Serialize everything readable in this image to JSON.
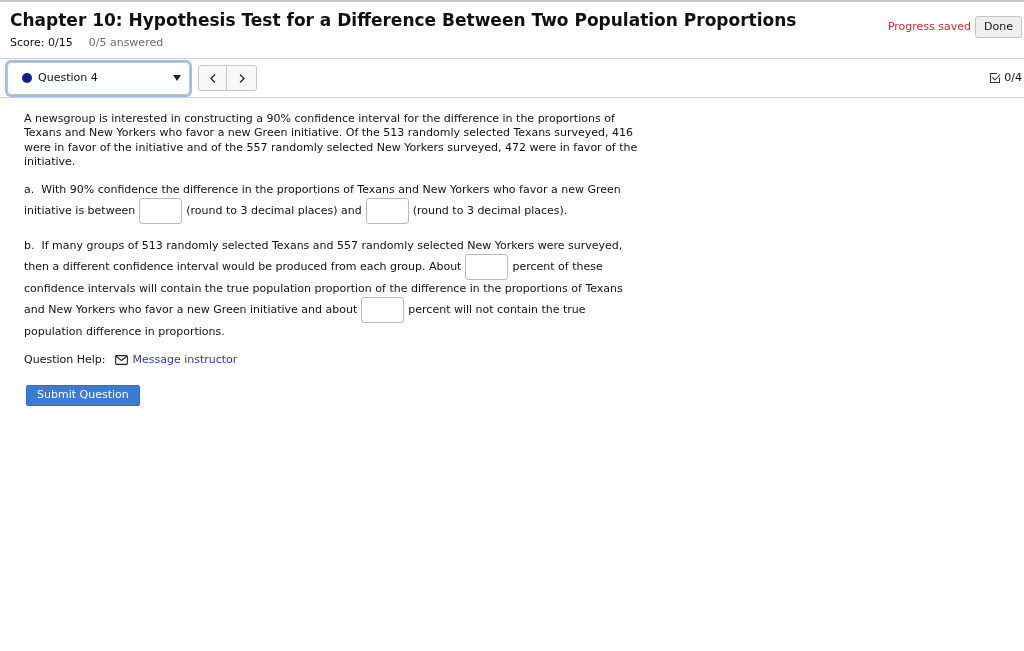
{
  "header": {
    "title": "Chapter 10: Hypothesis Test for a Difference Between Two Population Proportions",
    "score": "Score: 0/15",
    "answered": "0/5 answered",
    "status": "Progress saved",
    "done_button": "Done"
  },
  "question_nav": {
    "selector": "Question 4",
    "progress": "0/4"
  },
  "question": {
    "intro": "A newsgroup is interested in constructing a 90% confidence interval for the difference in the proportions of Texans and New Yorkers who favor a new Green initiative. Of the 513 randomly selected Texans surveyed, 416 were in favor of the initiative and of the 557 randomly selected New Yorkers surveyed, 472 were in favor of the initiative.",
    "parts": [
      {
        "label": "a.",
        "lines": [
          [
            {
              "kind": "text",
              "text": "With 90% confidence the difference in the proportions of Texans and New Yorkers who favor a new Green"
            }
          ],
          [
            {
              "kind": "text",
              "text": "initiative is between"
            },
            {
              "kind": "blank"
            },
            {
              "kind": "text",
              "text": "(round to 3 decimal places) and"
            },
            {
              "kind": "blank"
            },
            {
              "kind": "text",
              "text": "(round to 3 decimal places)."
            }
          ]
        ]
      },
      {
        "label": "b.",
        "lines": [
          [
            {
              "kind": "text",
              "text": "If many groups of 513 randomly selected Texans and 557 randomly selected New Yorkers were surveyed,"
            }
          ],
          [
            {
              "kind": "text",
              "text": "then a different confidence interval would be produced from each group. About"
            },
            {
              "kind": "blank"
            },
            {
              "kind": "text",
              "text": "percent of these"
            }
          ],
          [
            {
              "kind": "text",
              "text": "confidence intervals will contain the true population proportion of the difference in the proportions of Texans"
            }
          ],
          [
            {
              "kind": "text",
              "text": "and New Yorkers who favor a new Green initiative and about"
            },
            {
              "kind": "blank"
            },
            {
              "kind": "text",
              "text": "percent will not contain the true"
            }
          ],
          [
            {
              "kind": "text",
              "text": "population difference in proportions."
            }
          ]
        ]
      }
    ]
  },
  "help": {
    "label": "Question Help:",
    "link": "Message instructor"
  },
  "submit_button": "Submit Question"
}
